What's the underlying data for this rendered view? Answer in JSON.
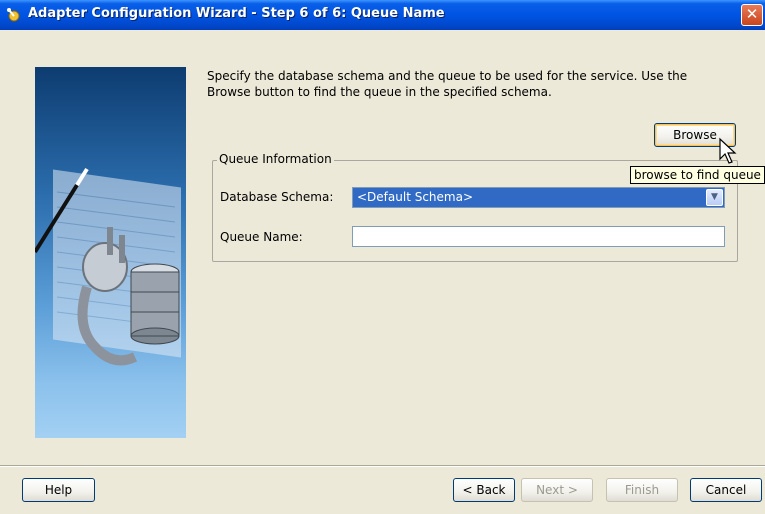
{
  "window": {
    "title": "Adapter Configuration Wizard - Step 6 of 6: Queue Name",
    "close_symbol": "✕",
    "icon": "wizard-icon"
  },
  "intro_text": "Specify the database schema and the queue to be used for the service. Use the\nBrowse button to find the queue in the specified schema.",
  "browse": {
    "label": "Browse",
    "tooltip": "browse to find queue"
  },
  "queue_info": {
    "legend": "Queue Information",
    "schema_label": "Database Schema:",
    "schema_value": "<Default Schema>",
    "queue_label": "Queue Name:",
    "queue_value": ""
  },
  "buttons": {
    "help": "Help",
    "back": "< Back",
    "next": "Next >",
    "finish": "Finish",
    "cancel": "Cancel"
  },
  "colors": {
    "title_bar": "#0054e3",
    "selection": "#316ac5",
    "dialog_bg": "#ece9d8",
    "tooltip_bg": "#ffffe1"
  }
}
